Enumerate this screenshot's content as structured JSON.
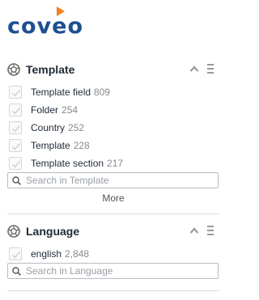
{
  "brand": {
    "logo_text": "coveo",
    "colors": {
      "logo_blue": "#1d4f91",
      "logo_orange": "#f58020",
      "facet_title": "#1f2a36",
      "count": "#8a8a8a"
    }
  },
  "facets": [
    {
      "title": "Template",
      "values": [
        {
          "caption": "Template field",
          "count": "809",
          "checked": false
        },
        {
          "caption": "Folder",
          "count": "254",
          "checked": false
        },
        {
          "caption": "Country",
          "count": "252",
          "checked": false
        },
        {
          "caption": "Template",
          "count": "228",
          "checked": false
        },
        {
          "caption": "Template section",
          "count": "217",
          "checked": false
        }
      ],
      "search_placeholder": "Search in Template",
      "more_label": "More"
    },
    {
      "title": "Language",
      "values": [
        {
          "caption": "english",
          "count": "2,848",
          "checked": false
        }
      ],
      "search_placeholder": "Search in Language"
    }
  ],
  "icons": {
    "facet": "facet-icon",
    "collapse": "chevron-up-icon",
    "settings": "menu-icon",
    "checkbox": "check-icon",
    "search": "search-icon"
  }
}
